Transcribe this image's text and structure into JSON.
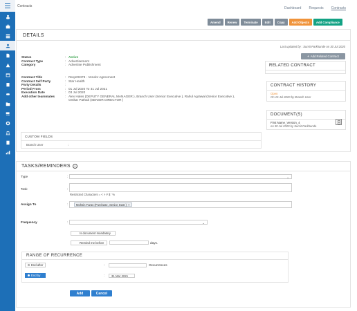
{
  "topbar": {
    "title": "Contracts",
    "nav": [
      "Dashboard",
      "Requests",
      "Contracts"
    ]
  },
  "toolbar": {
    "amend": "Amend",
    "renew": "Renew",
    "terminate": "Terminate",
    "edit": "Edit",
    "copy": "Copy",
    "add_objects": "Add Objects",
    "add_compliance": "Add Compliance"
  },
  "details": {
    "title": "DETAILS",
    "updated": "Last updated by : Sumit Parkhande  on  30 Jul 2020",
    "add_related": "Add Related Contract",
    "fields": [
      {
        "label": "Status",
        "value": "Active"
      },
      {
        "label": "Contract Type",
        "value": "Advertisement"
      },
      {
        "label": "Category",
        "value": "Advertise Publishment"
      },
      {
        "label": "",
        "value": ""
      },
      {
        "label": "Contract Title",
        "value": "Req100479 - Vendor Agreement"
      },
      {
        "label": "Contract Self Party",
        "value": "Star Health"
      },
      {
        "label": "Party Details",
        "value": ""
      },
      {
        "label": "Period From",
        "value": "01 Jul 2020   To 31 Jul 2021"
      },
      {
        "label": "Execution Date",
        "value": "03 Jul 2020"
      },
      {
        "label": "Add other teammates",
        "value": "Alex Hales (DEPUTY GENERAL MANAGER ), Branch User (Senior Executive ), Rahul Agrawal (Senior Executive ), Omkar Pathak (SENIOR DIRECTOR )"
      }
    ],
    "custom_fields": {
      "title": "CUSTOM FIELDS",
      "label": "Branch User",
      "value": ""
    }
  },
  "related": {
    "title": "RELATED CONTRACT"
  },
  "history": {
    "title": "CONTRACT HISTORY",
    "status": "Open",
    "detail": "On  15 Jul 2020  by Branch User"
  },
  "documents": {
    "title": "DOCUMENT(S)",
    "name": "First Name_Version_4",
    "detail": "on  30 Jul 2020  by Sumit Parkhande"
  },
  "tasks": {
    "title": "TASKS/REMINDERS",
    "toggle": "−",
    "type_label": "Type",
    "task_label": "Task",
    "restricted": "Restricted Characters = < > # $ ' %",
    "assign_label": "Assign To",
    "assignee": "Mohsin Faras (Purchase, Senior, East )",
    "chip_close": "×",
    "frequency_label": "Frequency",
    "mandatory": "Is document mandatory",
    "remind": "Remind me before",
    "days": "days.",
    "colon": ":",
    "chevron": "⌄"
  },
  "range": {
    "title": "RANGE OF RECURRENCE",
    "end_after": "End after",
    "occurrences": "Occurrences",
    "end_by": "End by",
    "end_by_date": "31 Mar 2021"
  },
  "actions": {
    "add": "Add",
    "cancel": "Cancel"
  },
  "colors": {
    "sidebar": "#1d6fb7",
    "primary_button": "#2f7fcf",
    "orange_button": "#f0933a",
    "teal_button": "#13a284",
    "active_status": "#2f9e44"
  }
}
